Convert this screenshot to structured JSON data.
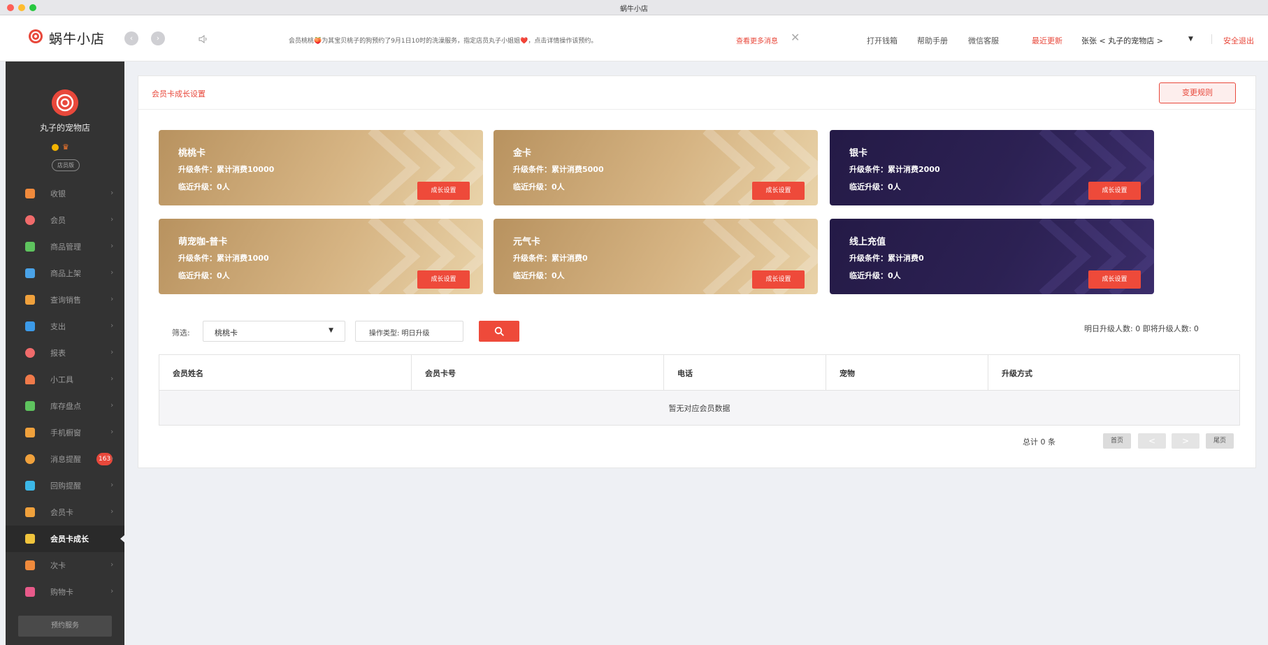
{
  "window": {
    "title": "蜗牛小店"
  },
  "header": {
    "logo_text": "蜗牛小店",
    "notice": "会员桃桃🍑为其宝贝桃子的狗预约了9月1日10时的洗澡服务，指定店员丸子小姐姐❤️，点击详情操作该预约。",
    "notice_more": "查看更多消息",
    "notice_close": "✕",
    "links": {
      "cash_drawer": "打开钱箱",
      "help": "帮助手册",
      "wechat": "微信客服",
      "recent": "最近更新",
      "user": "张张 < 丸子的宠物店 >",
      "logout": "安全退出"
    }
  },
  "sidebar": {
    "shop_name": "丸子的宠物店",
    "shop_tag": "店员版",
    "items": [
      {
        "label": "收银",
        "icon": "cashier-icon",
        "color": "#f08a3c"
      },
      {
        "label": "会员",
        "icon": "member-icon",
        "color": "#f06b6b"
      },
      {
        "label": "商品管理",
        "icon": "goods-icon",
        "color": "#5ec35e"
      },
      {
        "label": "商品上架",
        "icon": "shelf-icon",
        "color": "#4aa3e8"
      },
      {
        "label": "查询销售",
        "icon": "sales-icon",
        "color": "#f0a13c"
      },
      {
        "label": "支出",
        "icon": "expense-icon",
        "color": "#3c9ae8"
      },
      {
        "label": "报表",
        "icon": "report-icon",
        "color": "#f06b6b"
      },
      {
        "label": "小工具",
        "icon": "tools-icon",
        "color": "#f07a4a"
      },
      {
        "label": "库存盘点",
        "icon": "inventory-icon",
        "color": "#5ec35e"
      },
      {
        "label": "手机橱窗",
        "icon": "mobile-icon",
        "color": "#f0a13c"
      },
      {
        "label": "消息提醒",
        "icon": "message-icon",
        "color": "#f0a13c",
        "badge": "163"
      },
      {
        "label": "回购提醒",
        "icon": "repurchase-icon",
        "color": "#3cb8e8"
      },
      {
        "label": "会员卡",
        "icon": "card-icon",
        "color": "#f0a13c"
      },
      {
        "label": "会员卡成长",
        "icon": "growth-icon",
        "color": "#f0c43c",
        "active": true
      },
      {
        "label": "次卡",
        "icon": "times-card-icon",
        "color": "#f08a3c"
      },
      {
        "label": "购物卡",
        "icon": "shopping-card-icon",
        "color": "#e85a8a"
      }
    ],
    "bottom_button": "预约服务"
  },
  "panel": {
    "title": "会员卡成长设置",
    "change_rule": "变更规则",
    "cards": [
      {
        "name": "桃桃卡",
        "condition": "升级条件：累计消费10000",
        "near": "临近升级：0人",
        "button": "成长设置",
        "style": "gold"
      },
      {
        "name": "金卡",
        "condition": "升级条件：累计消费5000",
        "near": "临近升级：0人",
        "button": "成长设置",
        "style": "gold"
      },
      {
        "name": "银卡",
        "condition": "升级条件：累计消费2000",
        "near": "临近升级：0人",
        "button": "成长设置",
        "style": "purple"
      },
      {
        "name": "萌宠咖-普卡",
        "condition": "升级条件：累计消费1000",
        "near": "临近升级：0人",
        "button": "成长设置",
        "style": "gold"
      },
      {
        "name": "元气卡",
        "condition": "升级条件：累计消费0",
        "near": "临近升级：0人",
        "button": "成长设置",
        "style": "gold"
      },
      {
        "name": "线上充值",
        "condition": "升级条件：累计消费0",
        "near": "临近升级：0人",
        "button": "成长设置",
        "style": "purple"
      }
    ],
    "filter": {
      "label": "筛选:",
      "selected": "桃桃卡",
      "op_type": "操作类型: 明日升级",
      "upgrade_count": "明日升级人数: 0 即将升级人数: 0"
    },
    "table": {
      "columns": [
        "会员姓名",
        "会员卡号",
        "电话",
        "宠物",
        "升级方式"
      ],
      "empty": "暂无对应会员数据"
    },
    "pager": {
      "total": "总计  0  条",
      "first": "首页",
      "prev": "<",
      "next": ">",
      "last": "尾页"
    }
  }
}
